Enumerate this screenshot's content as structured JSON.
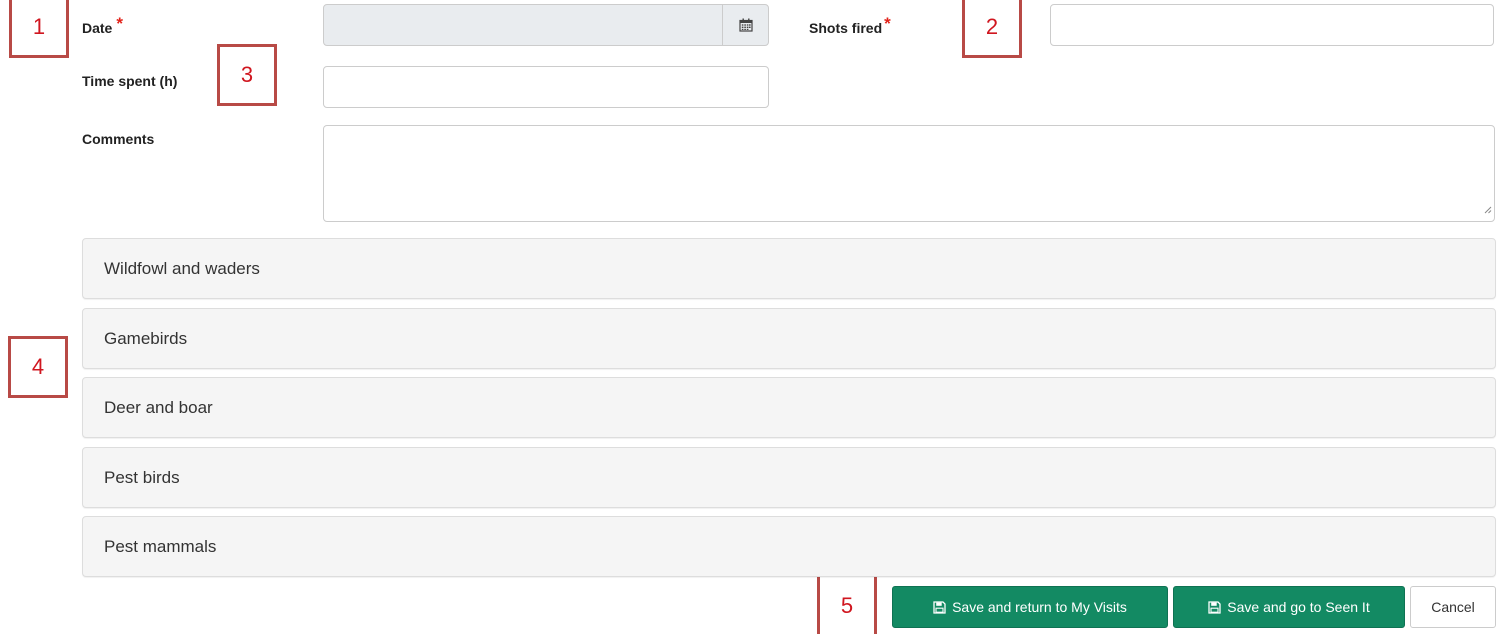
{
  "form": {
    "date": {
      "label": "Date",
      "required_mark": "*",
      "value": "",
      "button_icon": "calendar-icon"
    },
    "shots_fired": {
      "label": "Shots fired",
      "required_mark": "*",
      "value": ""
    },
    "time_spent": {
      "label": "Time spent (h)",
      "value": ""
    },
    "comments": {
      "label": "Comments",
      "value": ""
    }
  },
  "sections": [
    {
      "label": "Wildfowl and waders"
    },
    {
      "label": "Gamebirds"
    },
    {
      "label": "Deer and boar"
    },
    {
      "label": "Pest birds"
    },
    {
      "label": "Pest mammals"
    }
  ],
  "actions": {
    "save_return_label": "Save and return to My Visits",
    "save_seen_label": "Save and go to Seen It",
    "cancel_label": "Cancel",
    "save_icon": "floppy-disk-icon"
  },
  "annotations": [
    "1",
    "2",
    "3",
    "4",
    "5"
  ],
  "colors": {
    "primary": "#138a63",
    "required": "#e2231a",
    "marker_border": "#b84a46",
    "marker_text": "#d0161f",
    "panel_bg": "#f5f5f5",
    "disabled_bg": "#e9ecef"
  }
}
